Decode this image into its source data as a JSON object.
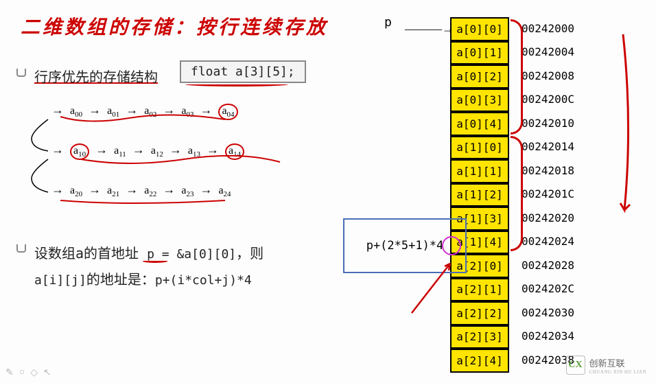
{
  "title": "二维数组的存储：按行连续存放",
  "section1": {
    "heading": "行序优先的存储结构",
    "code": "float a[3][5];"
  },
  "diagram": {
    "rows": [
      [
        "a00",
        "a01",
        "a02",
        "a03",
        "a04"
      ],
      [
        "a10",
        "a11",
        "a12",
        "a13",
        "a14"
      ],
      [
        "a20",
        "a21",
        "a22",
        "a23",
        "a24"
      ]
    ]
  },
  "section2": {
    "line1_a": "设数组a的首地址 ",
    "line1_b": "p = &a[0][0]",
    "line1_c": "，则",
    "line2_a": "a[i][j]",
    "line2_b": "的地址是：",
    "line2_c": "p+(i*col+j)*4"
  },
  "pointer_label": "p",
  "memory": [
    {
      "label": "a[0][0]",
      "addr": "00242000"
    },
    {
      "label": "a[0][1]",
      "addr": "00242004"
    },
    {
      "label": "a[0][2]",
      "addr": "00242008"
    },
    {
      "label": "a[0][3]",
      "addr": "0024200C"
    },
    {
      "label": "a[0][4]",
      "addr": "00242010"
    },
    {
      "label": "a[1][0]",
      "addr": "00242014"
    },
    {
      "label": "a[1][1]",
      "addr": "00242018"
    },
    {
      "label": "a[1][2]",
      "addr": "0024201C"
    },
    {
      "label": "a[1][3]",
      "addr": "00242020"
    },
    {
      "label": "a[1][4]",
      "addr": "00242024"
    },
    {
      "label": "a[2][0]",
      "addr": "00242028"
    },
    {
      "label": "a[2][1]",
      "addr": "0024202C"
    },
    {
      "label": "a[2][2]",
      "addr": "00242030"
    },
    {
      "label": "a[2][3]",
      "addr": "00242034"
    },
    {
      "label": "a[2][4]",
      "addr": "00242038"
    }
  ],
  "formula": "p+(2*5+1)*4",
  "watermark": {
    "logo": "CX",
    "line1": "创新互联",
    "line2": "CHUANG XIN HU LIAN"
  }
}
